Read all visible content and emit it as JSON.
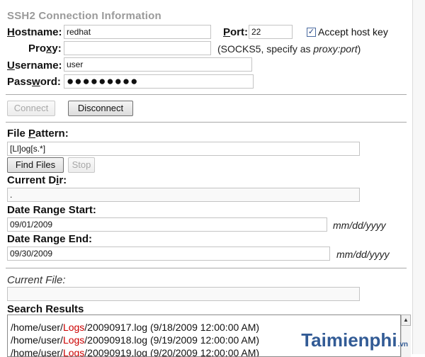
{
  "title": "SSH2 Connection Information",
  "connection": {
    "hostname_label_pre": "H",
    "hostname_label_post": "ostname:",
    "hostname_value": "redhat",
    "port_label_pre": "P",
    "port_label_post": "ort:",
    "port_value": "22",
    "accept_host_key_label": "Accept host key",
    "accept_host_key_checked": "✓",
    "proxy_label_pre": "Pro",
    "proxy_label_mid": "x",
    "proxy_label_post": "y:",
    "proxy_value": "",
    "proxy_hint_pre": "(SOCKS5, specify as ",
    "proxy_hint_em": "proxy:port",
    "proxy_hint_post": ")",
    "username_label_pre": "U",
    "username_label_post": "sername:",
    "username_value": "user",
    "password_label_pre": "Pass",
    "password_label_mid": "w",
    "password_label_post": "ord:",
    "password_value": "●●●●●●●●●"
  },
  "buttons": {
    "connect": "Connect",
    "disconnect": "Disconnect",
    "find_files": "Find Files",
    "stop": "Stop"
  },
  "search": {
    "file_pattern_label_pre": "File ",
    "file_pattern_label_mid": "P",
    "file_pattern_label_post": "attern:",
    "file_pattern_value": "[Ll]og[s.*]",
    "current_dir_label_pre": "Current D",
    "current_dir_label_mid": "i",
    "current_dir_label_post": "r:",
    "current_dir_value": ".",
    "date_start_label": "Date Range Start:",
    "date_start_value": "09/01/2009",
    "date_start_hint": "mm/dd/yyyy",
    "date_end_label": "Date Range End:",
    "date_end_value": "09/30/2009",
    "date_end_hint": "mm/dd/yyyy",
    "current_file_label": "Current File:",
    "current_file_value": ""
  },
  "results": {
    "label": "Search Results",
    "rows": [
      {
        "pre": "/home/user/",
        "red": "Logs",
        "post": "/20090917.log (9/18/2009 12:00:00 AM)"
      },
      {
        "pre": "/home/user/",
        "red": "Logs",
        "post": "/20090918.log (9/19/2009 12:00:00 AM)"
      },
      {
        "pre": "/home/user/",
        "red": "Logs",
        "post": "/20090919.log (9/20/2009 12:00:00 AM)"
      }
    ]
  },
  "watermark": {
    "brand": "Taimienphi",
    "domain": ".vn"
  },
  "colors": {
    "title_gray": "#9a9a9a",
    "highlight_red": "#cc0000",
    "separator": "#a9a9a9"
  }
}
